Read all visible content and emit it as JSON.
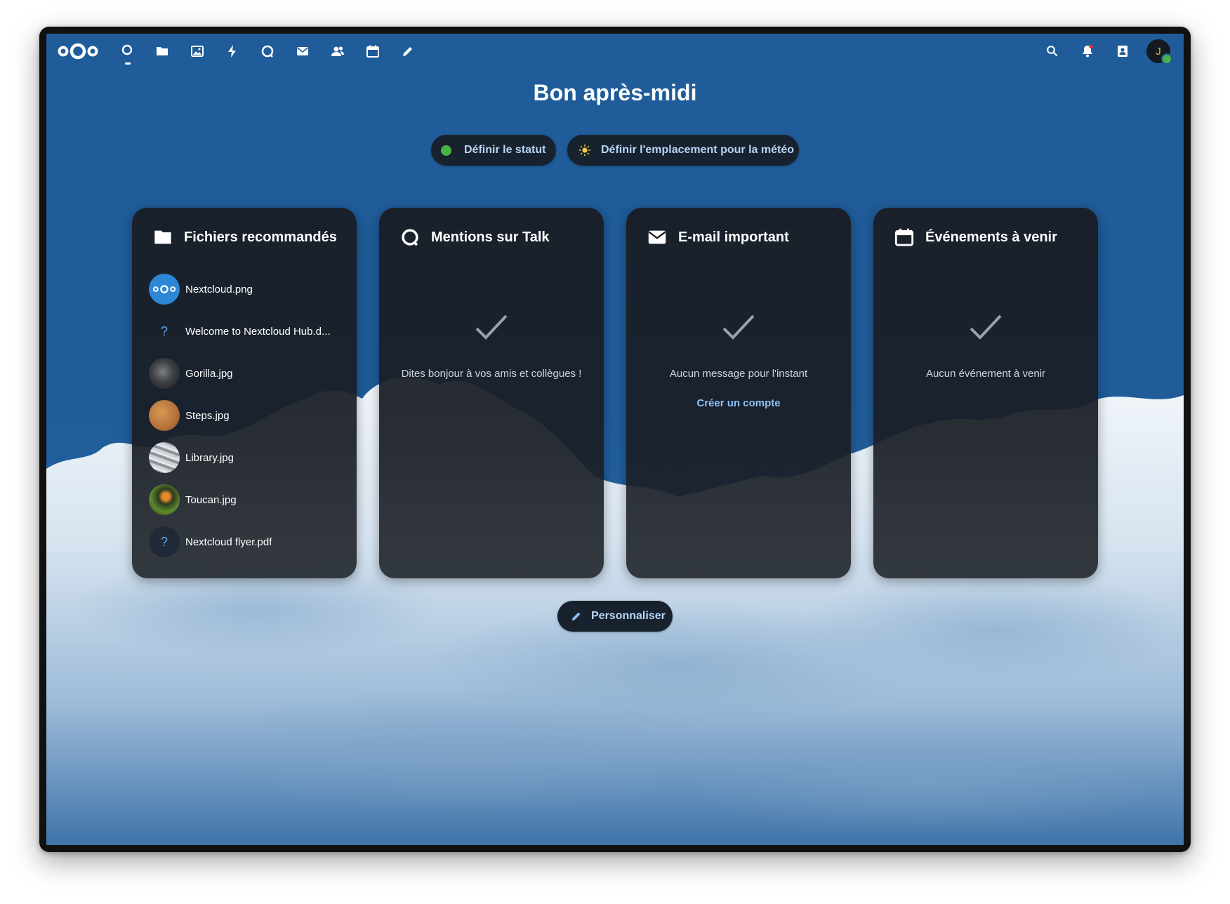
{
  "header": {
    "apps": [
      {
        "name": "dashboard-icon"
      },
      {
        "name": "files-icon"
      },
      {
        "name": "photos-icon"
      },
      {
        "name": "activity-icon"
      },
      {
        "name": "talk-icon"
      },
      {
        "name": "mail-icon"
      },
      {
        "name": "contacts-icon"
      },
      {
        "name": "calendar-icon"
      },
      {
        "name": "notes-icon"
      }
    ],
    "right_icons": [
      "search-icon",
      "notifications-icon",
      "contacts-menu-icon"
    ],
    "avatar_initial": "J"
  },
  "greeting": "Bon après-midi",
  "actions": {
    "status_label": "Définir le statut",
    "weather_label": "Définir l'emplacement pour la météo"
  },
  "widgets": {
    "files": {
      "title": "Fichiers recommandés",
      "items": [
        {
          "name": "Nextcloud.png",
          "thumb": "nextcloud-logo"
        },
        {
          "name": "Welcome to Nextcloud Hub.d...",
          "thumb": "unknown-file-icon"
        },
        {
          "name": "Gorilla.jpg",
          "thumb": "gorilla-photo"
        },
        {
          "name": "Steps.jpg",
          "thumb": "steps-photo"
        },
        {
          "name": "Library.jpg",
          "thumb": "library-photo"
        },
        {
          "name": "Toucan.jpg",
          "thumb": "toucan-photo"
        },
        {
          "name": "Nextcloud flyer.pdf",
          "thumb": "unknown-file-icon"
        }
      ]
    },
    "talk": {
      "title": "Mentions sur Talk",
      "empty_text": "Dites bonjour à vos amis et collègues !"
    },
    "mail": {
      "title": "E-mail important",
      "empty_text": "Aucun message pour l'instant",
      "link": "Créer un compte"
    },
    "calendar": {
      "title": "Événements à venir",
      "empty_text": "Aucun événement à venir"
    }
  },
  "customize_label": "Personnaliser",
  "colors": {
    "background": "#1e5a97",
    "card": "#191e26",
    "accent_text": "#b6d6f8",
    "status_online": "#49b34a"
  }
}
